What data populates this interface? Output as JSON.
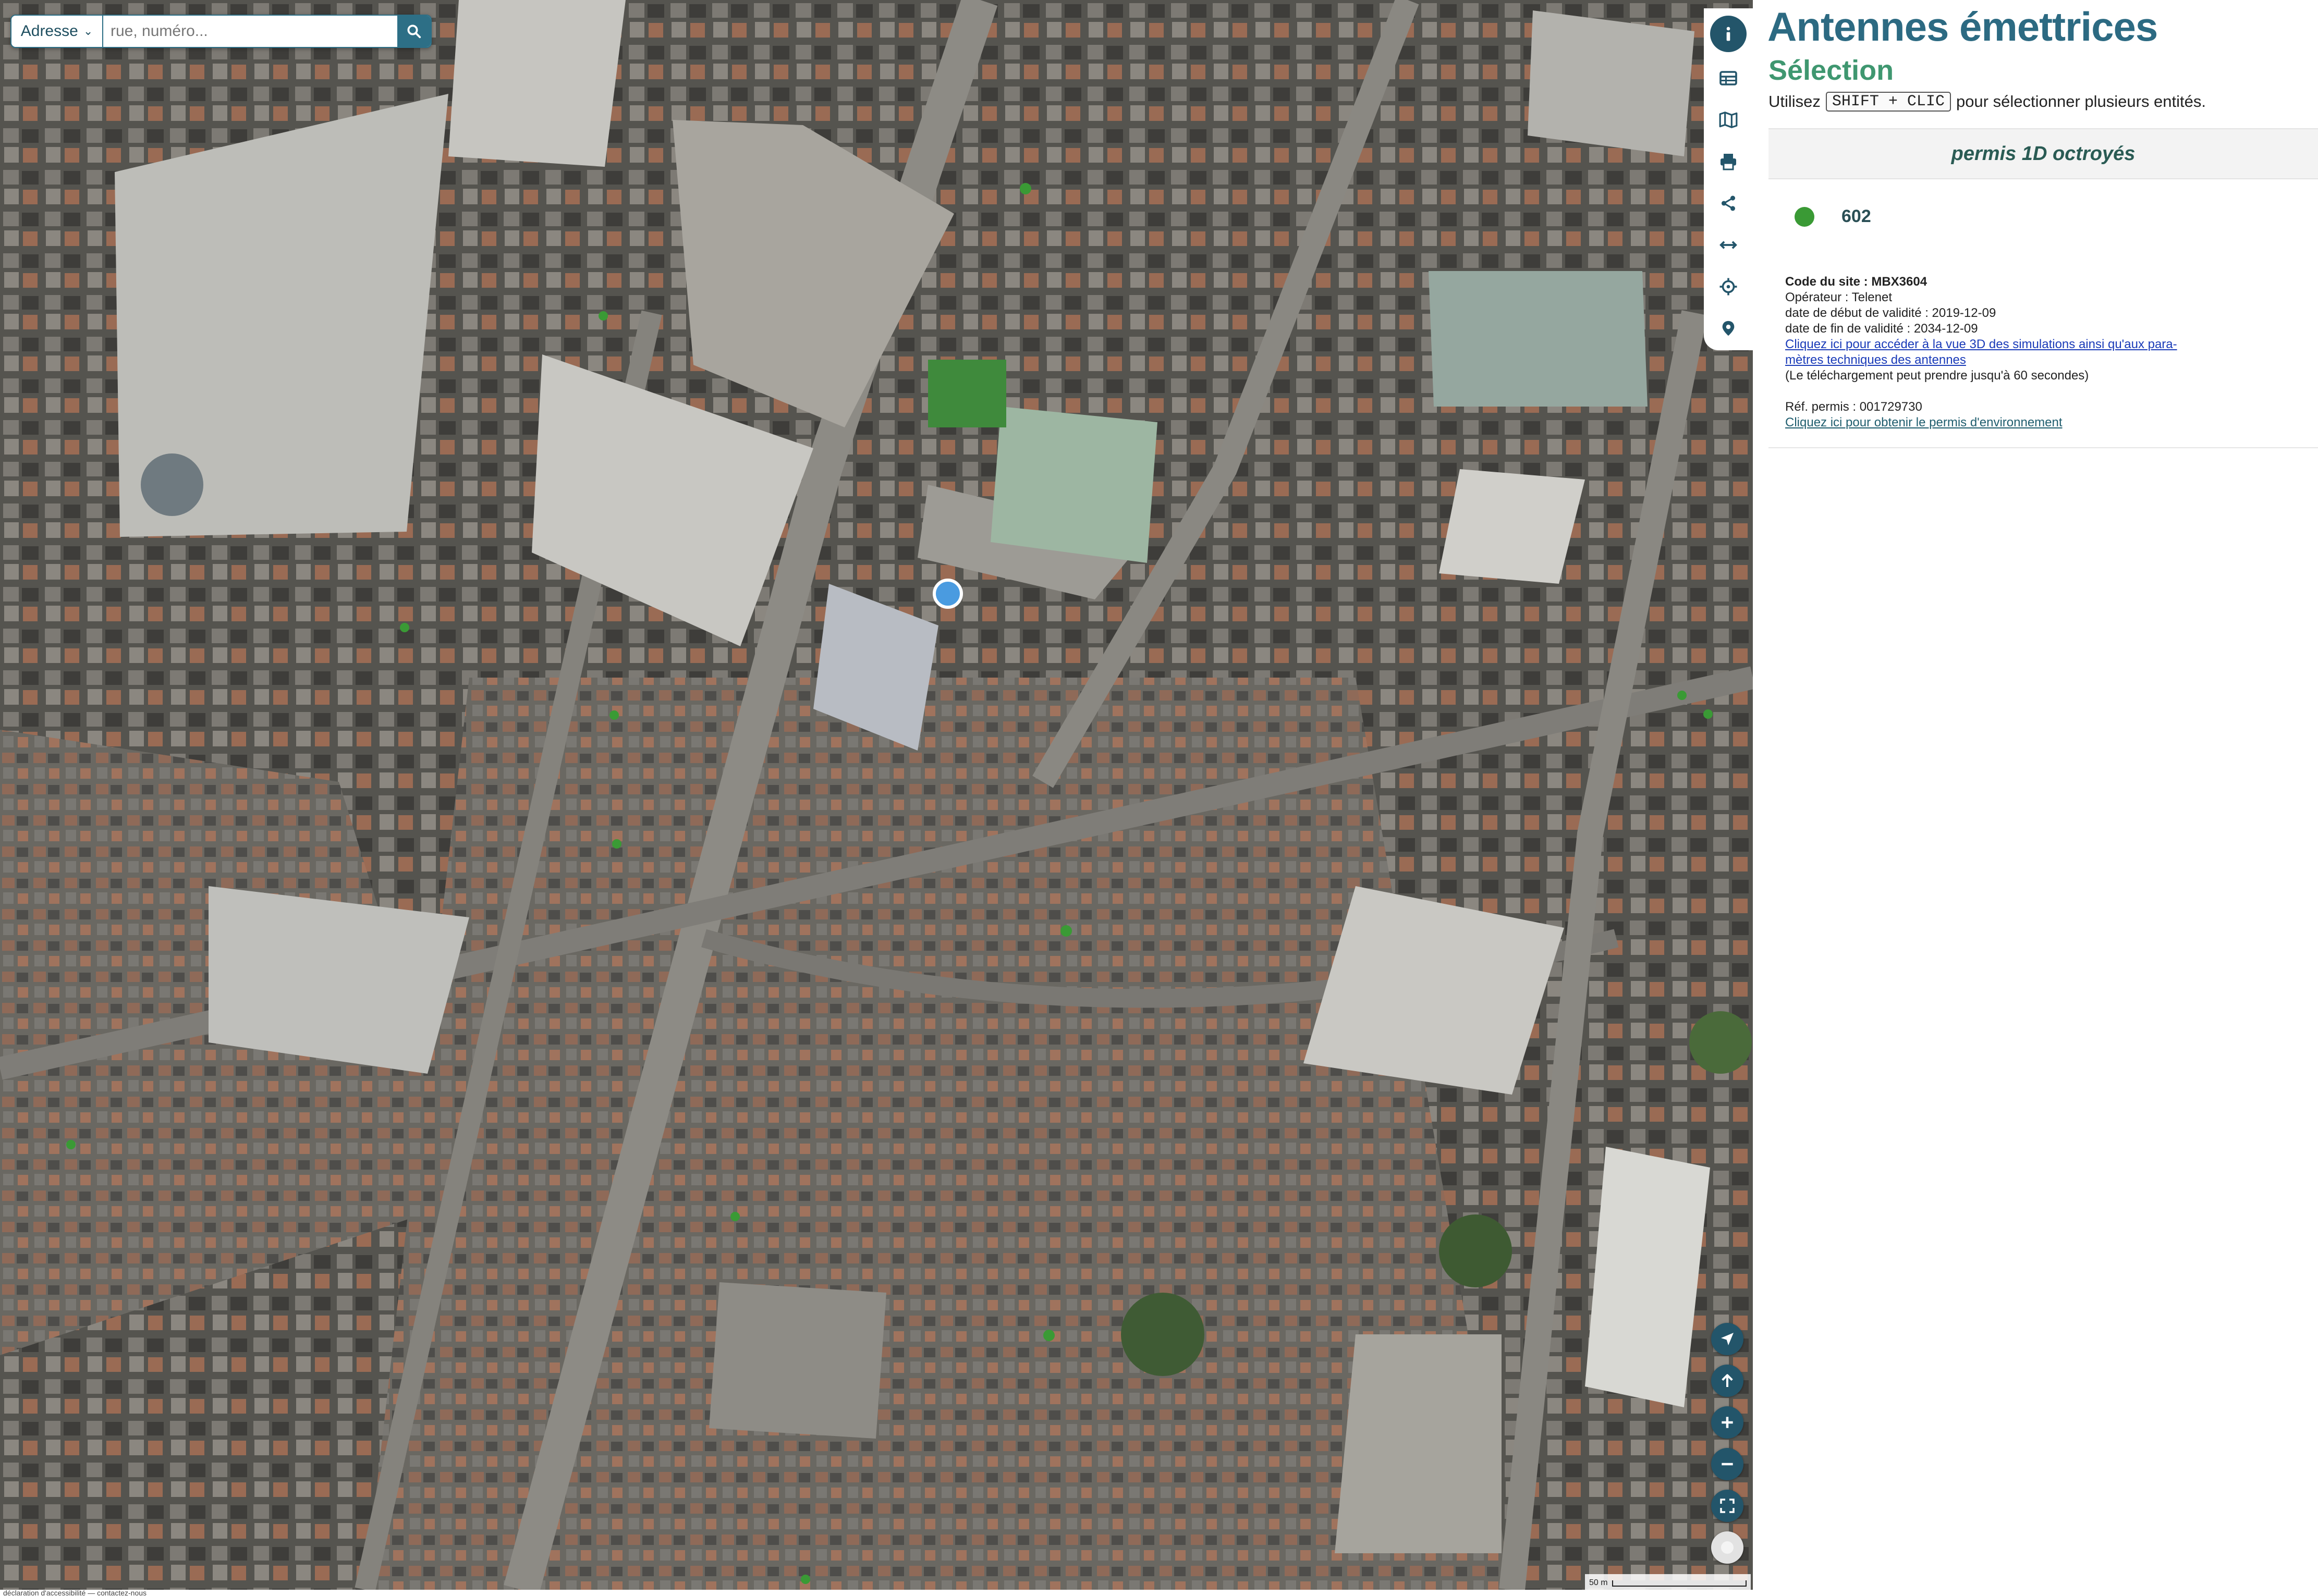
{
  "search": {
    "type_label": "Adresse",
    "placeholder": "rue, numéro..."
  },
  "toolbar": [
    {
      "icon": "info-icon",
      "label": "Information"
    },
    {
      "icon": "table-icon",
      "label": "Table"
    },
    {
      "icon": "map-icon",
      "label": "Map"
    },
    {
      "icon": "print-icon",
      "label": "Print"
    },
    {
      "icon": "share-icon",
      "label": "Share"
    },
    {
      "icon": "measure-icon",
      "label": "Measure"
    },
    {
      "icon": "crosshair-icon",
      "label": "Locate"
    },
    {
      "icon": "location-pin-icon",
      "label": "Marker"
    }
  ],
  "map_controls": [
    {
      "icon": "navigation-arrow-icon"
    },
    {
      "icon": "north-arrow-icon"
    },
    {
      "icon": "zoom-in-icon"
    },
    {
      "icon": "zoom-out-icon"
    },
    {
      "icon": "fullscreen-icon"
    },
    {
      "icon": "basemap-toggle-icon"
    }
  ],
  "scale": {
    "label": "50 m"
  },
  "footer": {
    "text": "déclaration d'accessibilité — contactez-nous"
  },
  "panel": {
    "title": "Antennes émettrices",
    "subtitle": "Sélection",
    "hint_prefix": "Utilisez",
    "hint_key": "SHIFT + CLIC",
    "hint_suffix": "pour sélectionner plusieurs entités.",
    "layer_name": "permis 1D octroyés",
    "feature_value": "602",
    "feature_color": "#3a9a35",
    "details": {
      "site_code_label": "Code du site : MBX3604",
      "operator": "Opérateur : Telenet",
      "start_date": "date de début de validité : 2019-12-09",
      "end_date": "date de fin de validité : 2034-12-09",
      "link_3d_line1": "Cliquez ici pour accéder à la vue 3D des simulations ainsi qu'aux para-",
      "link_3d_line2": "mètres techniques des antennes",
      "download_note": "(Le téléchargement peut prendre jusqu'à 60 secondes)",
      "permit_ref": "Réf. permis : 001729730",
      "link_permit": "Cliquez ici pour obtenir le permis d'environnement"
    }
  },
  "colors": {
    "primary": "#2c6a82",
    "accent_green": "#3f9770",
    "marker_blue": "#4a9be0",
    "antenna_green": "#3a9a35"
  }
}
